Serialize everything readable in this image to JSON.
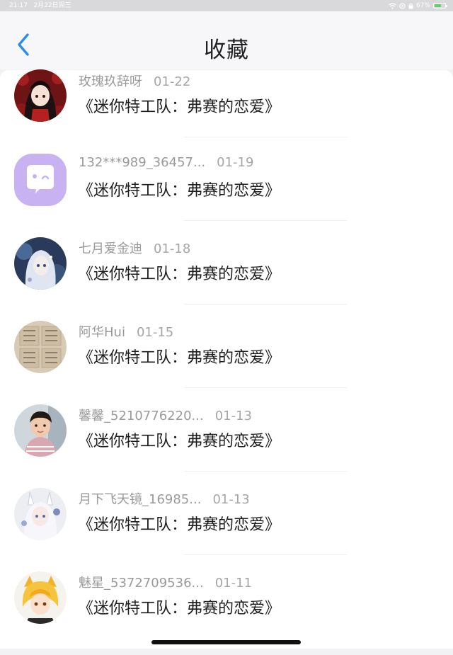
{
  "status_bar": {
    "time": "21:17",
    "date": "2月22日周三",
    "battery": "67%",
    "battery_level": 0.67
  },
  "header": {
    "title": "收藏",
    "back_icon": "chevron-left-icon",
    "accent": "#2b8de8"
  },
  "items": [
    {
      "user": "玫瑰玖辞呀",
      "date": "01-22",
      "title": "《迷你特工队：弗赛的恋爱》",
      "avatar": "anime-girl-red"
    },
    {
      "user": "132***989_36457...",
      "date": "01-19",
      "title": "《迷你特工队：弗赛的恋爱》",
      "avatar": "chat-bubble-icon"
    },
    {
      "user": "七月爱金迪",
      "date": "01-18",
      "title": "《迷你特工队：弗赛的恋爱》",
      "avatar": "anime-girl-blue"
    },
    {
      "user": "阿华Hui",
      "date": "01-15",
      "title": "《迷你特工队：弗赛的恋爱》",
      "avatar": "calligraphy-paper"
    },
    {
      "user": "馨馨_5210776220...",
      "date": "01-13",
      "title": "《迷你特工队：弗赛的恋爱》",
      "avatar": "child-photo"
    },
    {
      "user": "月下飞天镜_16985...",
      "date": "01-13",
      "title": "《迷你特工队：弗赛的恋爱》",
      "avatar": "anime-girl-white"
    },
    {
      "user": "魅星_5372709536...",
      "date": "01-11",
      "title": "《迷你特工队：弗赛的恋爱》",
      "avatar": "anime-boy-yellow"
    }
  ]
}
